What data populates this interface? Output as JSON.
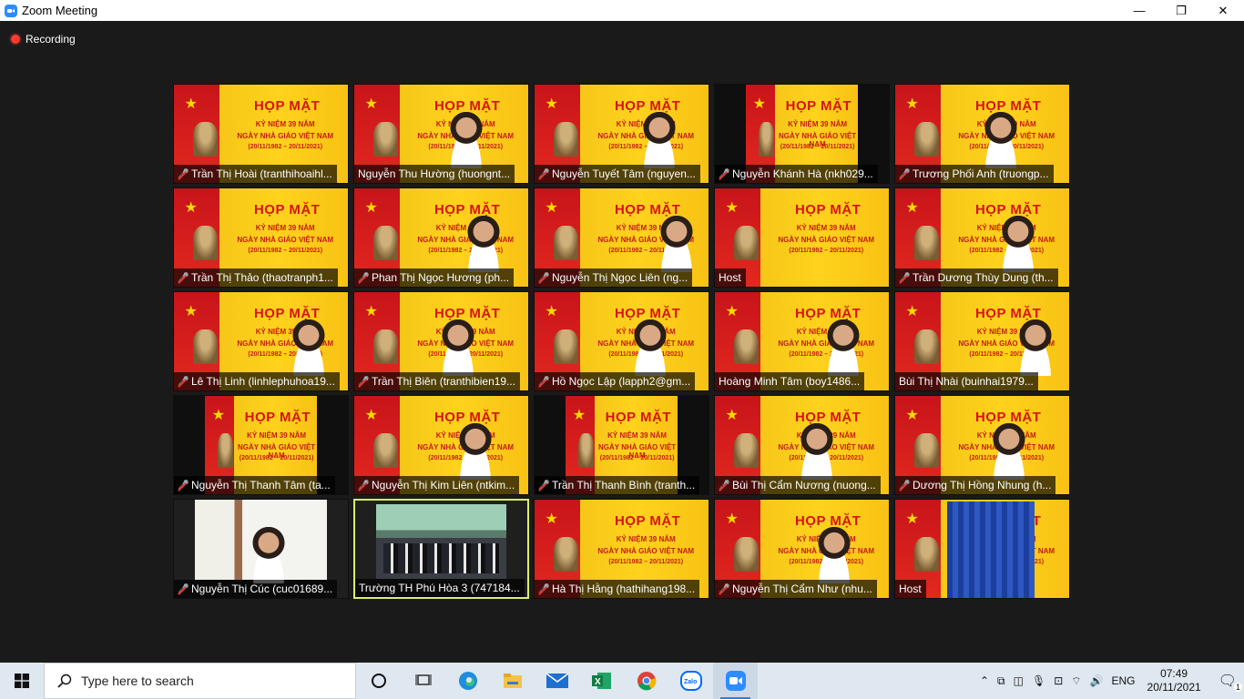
{
  "window": {
    "title": "Zoom Meeting",
    "minimize": "—",
    "maximize": "❐",
    "close": "✕"
  },
  "recording": {
    "label": "Recording"
  },
  "slide": {
    "headline": "HỌP MẶT",
    "line1": "KỶ NIỆM 39 NĂM",
    "line2": "NGÀY NHÀ GIÁO VIỆT NAM",
    "line3": "(20/11/1982 – 20/11/2021)"
  },
  "participants": [
    {
      "name": "Trần Thị Hoài (tranthihoaihl...",
      "muted": true
    },
    {
      "name": "Nguyễn Thu Hường (huongnt...",
      "muted": false
    },
    {
      "name": "Nguyễn Tuyết Tâm (nguyen...",
      "muted": true
    },
    {
      "name": "Nguyễn Khánh Hà (nkh029...",
      "muted": true
    },
    {
      "name": "Trương Phối Anh (truongp...",
      "muted": true
    },
    {
      "name": "Trần Thị Thảo (thaotranph1...",
      "muted": true
    },
    {
      "name": "Phan Thị Ngọc Hương (ph...",
      "muted": true
    },
    {
      "name": "Nguyễn Thị Ngọc Liên (ng...",
      "muted": true
    },
    {
      "name": "Host",
      "muted": false
    },
    {
      "name": "Trần Dương Thùy Dung (th...",
      "muted": true
    },
    {
      "name": "Lê Thị Linh (linhlephuhoa19...",
      "muted": true
    },
    {
      "name": "Trần Thị Biên (tranthibien19...",
      "muted": true
    },
    {
      "name": "Hồ Ngọc Lập (lapph2@gm...",
      "muted": true
    },
    {
      "name": "Hoàng Minh Tâm (boy1486...",
      "muted": false
    },
    {
      "name": "Bùi Thị Nhài (buinhai1979...",
      "muted": false
    },
    {
      "name": "Nguyễn Thị Thanh Tâm (ta...",
      "muted": true
    },
    {
      "name": "Nguyễn Thị Kim Liên (ntkim...",
      "muted": true
    },
    {
      "name": "Trần Thị Thanh Bình (tranth...",
      "muted": true
    },
    {
      "name": "Bùi Thị Cẩm Nương (nuong...",
      "muted": true
    },
    {
      "name": "Dương Thị Hồng Nhung (h...",
      "muted": true
    },
    {
      "name": "Nguyễn Thị Cúc (cuc01689...",
      "muted": true
    },
    {
      "name": "Trường TH Phú Hòa 3 (747184...",
      "muted": false
    },
    {
      "name": "Hà Thị Hằng (hathihang198...",
      "muted": true
    },
    {
      "name": "Nguyễn Thị Cẩm Như (nhu...",
      "muted": true
    },
    {
      "name": "Host",
      "muted": false
    }
  ],
  "taskbar": {
    "search_placeholder": "Type here to search",
    "language": "ENG",
    "time": "07:49",
    "date": "20/11/2021",
    "notifications_count": "1"
  }
}
